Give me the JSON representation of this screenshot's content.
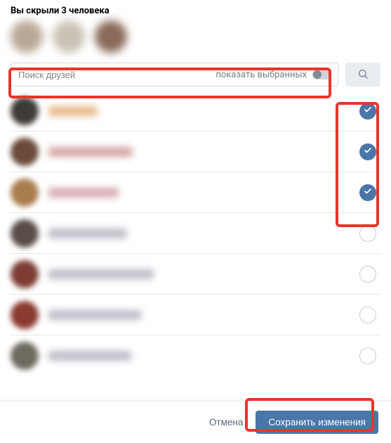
{
  "header": {
    "title": "Вы скрыли 3 человека"
  },
  "search": {
    "placeholder": "Поиск друзей",
    "toggle_label": "показать выбранных"
  },
  "colors": {
    "accent": "#4a76a8",
    "highlight": "#e7352b"
  },
  "friends": [
    {
      "selected": true,
      "avatar_color": "#3f3a36",
      "name_width": 70,
      "name_color": "#e7b98a"
    },
    {
      "selected": true,
      "avatar_color": "#6b4a3a",
      "name_width": 120,
      "name_color": "#d6a6a3"
    },
    {
      "selected": true,
      "avatar_color": "#a87d4e",
      "name_width": 100,
      "name_color": "#d6abb0"
    },
    {
      "selected": false,
      "avatar_color": "#5a4d48",
      "name_width": 112,
      "name_color": "#bfbcc7"
    },
    {
      "selected": false,
      "avatar_color": "#7d3d34",
      "name_width": 150,
      "name_color": "#bfbcc7"
    },
    {
      "selected": false,
      "avatar_color": "#8a3a30",
      "name_width": 132,
      "name_color": "#bfbcc7"
    },
    {
      "selected": false,
      "avatar_color": "#6e6a60",
      "name_width": 118,
      "name_color": "#bfbcc7"
    }
  ],
  "footer": {
    "cancel": "Отмена",
    "save": "Сохранить изменения"
  }
}
